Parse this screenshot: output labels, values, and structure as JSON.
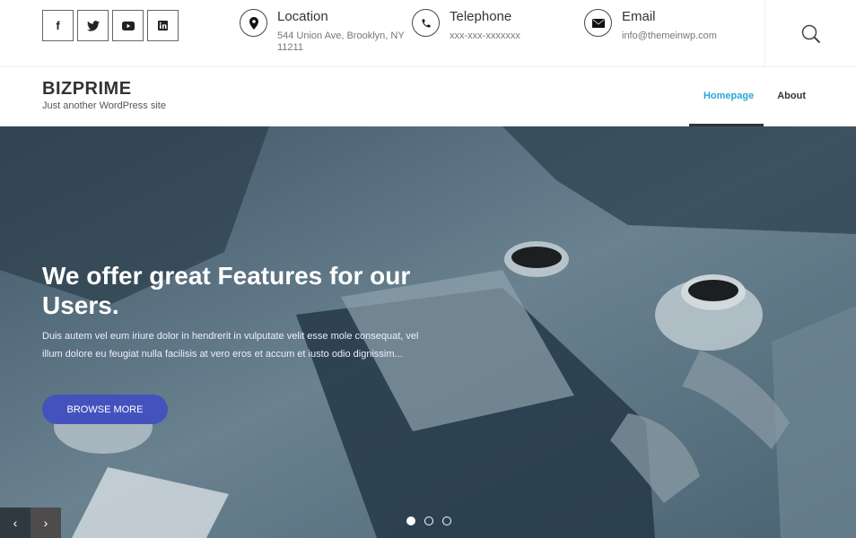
{
  "topbar": {
    "social": [
      {
        "icon": "facebook-icon",
        "glyph": "f"
      },
      {
        "icon": "twitter-icon",
        "glyph": "🐦"
      },
      {
        "icon": "youtube-icon",
        "glyph": "▶"
      },
      {
        "icon": "linkedin-icon",
        "glyph": "in"
      }
    ],
    "location": {
      "title": "Location",
      "value": "544 Union Ave, Brooklyn, NY 11211"
    },
    "telephone": {
      "title": "Telephone",
      "value": "xxx-xxx-xxxxxxx"
    },
    "email": {
      "title": "Email",
      "value": "info@themeinwp.com"
    }
  },
  "brand": {
    "name": "BIZPRIME",
    "tagline": "Just another WordPress site"
  },
  "nav": {
    "items": [
      {
        "label": "Homepage",
        "active": true
      },
      {
        "label": "About",
        "active": false
      }
    ]
  },
  "hero": {
    "title": "We offer great Features for our Users.",
    "text": "Duis autem vel eum iriure dolor in hendrerit in vulputate velit esse mole consequat, vel illum dolore eu feugiat nulla facilisis at vero eros et accum et iusto odio dignissim...",
    "button": "BROWSE MORE",
    "slides": 3,
    "active_slide": 1,
    "prev": "‹",
    "next": "›"
  },
  "colors": {
    "accent": "#29a8d8",
    "button": "#4352bd"
  }
}
